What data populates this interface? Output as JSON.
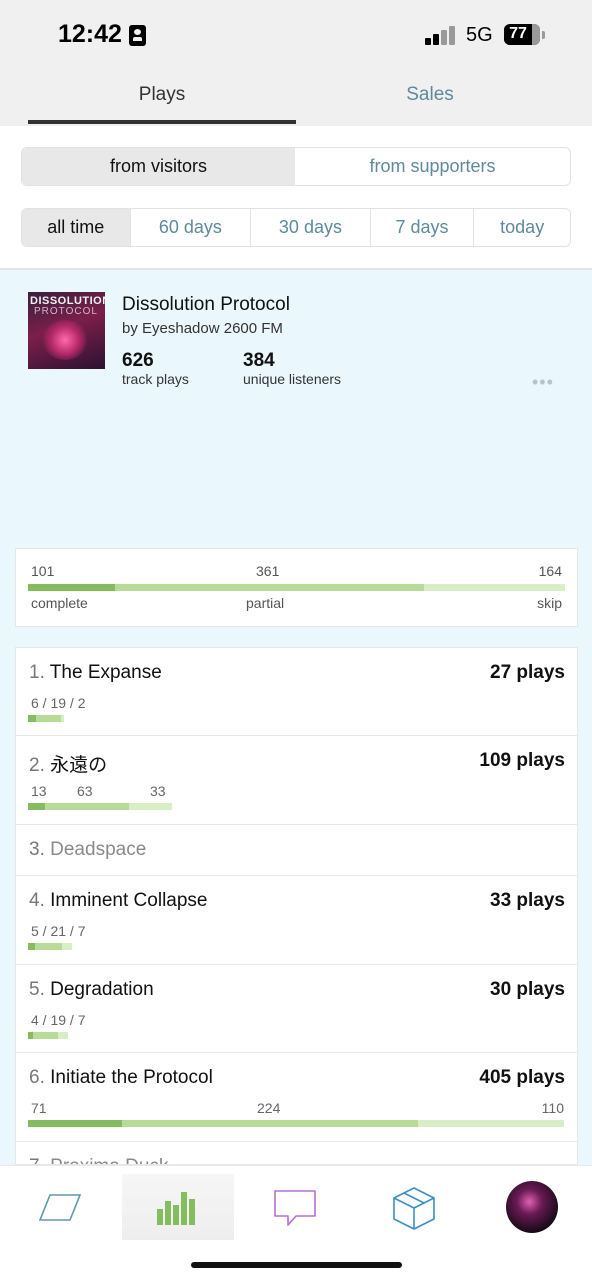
{
  "status_bar": {
    "time": "12:42",
    "network": "5G",
    "battery": "77"
  },
  "top_tabs": [
    {
      "label": "Plays",
      "active": true
    },
    {
      "label": "Sales",
      "active": false
    }
  ],
  "source_filter": [
    {
      "label": "from visitors",
      "active": true
    },
    {
      "label": "from supporters",
      "active": false
    }
  ],
  "time_filter": [
    {
      "label": "all time",
      "active": true
    },
    {
      "label": "60 days",
      "active": false
    },
    {
      "label": "30 days",
      "active": false
    },
    {
      "label": "7 days",
      "active": false
    },
    {
      "label": "today",
      "active": false
    }
  ],
  "album": {
    "title": "Dissolution Protocol",
    "artist": "by Eyeshadow 2600 FM",
    "cover_text_1": "DISSOLUTION",
    "cover_text_2": "PROTOCOL",
    "track_plays": "626",
    "track_plays_label": "track plays",
    "unique_listeners": "384",
    "unique_listeners_label": "unique listeners",
    "more": "•••"
  },
  "summary": {
    "complete": {
      "value": "101",
      "label": "complete"
    },
    "partial": {
      "value": "361",
      "label": "partial"
    },
    "skip": {
      "value": "164",
      "label": "skip"
    }
  },
  "tracks": [
    {
      "num": "1.",
      "title": "The Expanse",
      "plays": "27 plays",
      "breakdown": "6 / 19 / 2",
      "complete": 6,
      "partial": 19,
      "skip": 2
    },
    {
      "num": "2.",
      "title": "永遠の",
      "plays": "109 plays",
      "complete_label": "13",
      "partial_label": "63",
      "skip_label": "33",
      "complete": 13,
      "partial": 63,
      "skip": 33
    },
    {
      "num": "3.",
      "title": "Deadspace",
      "plays": ""
    },
    {
      "num": "4.",
      "title": "Imminent Collapse",
      "plays": "33 plays",
      "breakdown": "5 / 21 / 7",
      "complete": 5,
      "partial": 21,
      "skip": 7
    },
    {
      "num": "5.",
      "title": "Degradation",
      "plays": "30 plays",
      "breakdown": "4 / 19 / 7",
      "complete": 4,
      "partial": 19,
      "skip": 7
    },
    {
      "num": "6.",
      "title": "Initiate the Protocol",
      "plays": "405 plays",
      "complete_label": "71",
      "partial_label": "224",
      "skip_label": "110",
      "complete": 71,
      "partial": 224,
      "skip": 110
    },
    {
      "num": "7.",
      "title": "Proxima Duck",
      "plays": ""
    }
  ],
  "bottom_nav": [
    {
      "icon": "feed-icon",
      "active": false
    },
    {
      "icon": "stats-icon",
      "active": true
    },
    {
      "icon": "messages-icon",
      "active": false
    },
    {
      "icon": "merch-box-icon",
      "active": false
    },
    {
      "icon": "profile-avatar",
      "active": false
    }
  ],
  "colors": {
    "accent_text": "#5d8b9c",
    "bar_complete": "#86bc60",
    "bar_partial": "#b6dc97",
    "bar_skip": "#d8eec5",
    "album_background": "#eaf7fd"
  }
}
